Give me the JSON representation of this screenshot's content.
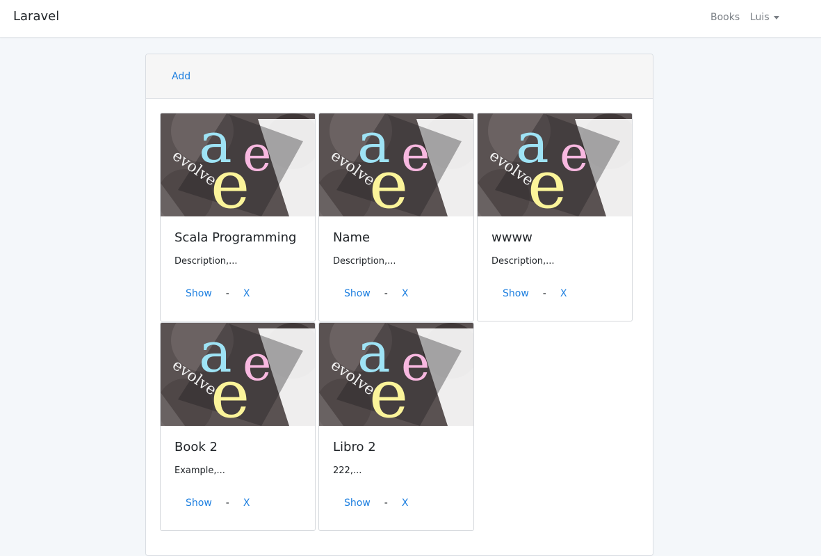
{
  "navbar": {
    "brand": "Laravel",
    "links": {
      "books": "Books",
      "user": "Luis"
    }
  },
  "panel": {
    "add_label": "Add"
  },
  "cover": {
    "word": "evolve",
    "letters": [
      "a",
      "e",
      "e"
    ]
  },
  "books": [
    {
      "title": "Scala Programming",
      "description": "Description,...",
      "show_label": "Show",
      "separator": "-",
      "delete_label": "X"
    },
    {
      "title": "Name",
      "description": "Description,...",
      "show_label": "Show",
      "separator": "-",
      "delete_label": "X"
    },
    {
      "title": "wwww",
      "description": "Description,...",
      "show_label": "Show",
      "separator": "-",
      "delete_label": "X"
    },
    {
      "title": "Book 2",
      "description": "Example,...",
      "show_label": "Show",
      "separator": "-",
      "delete_label": "X"
    },
    {
      "title": "Libro 2",
      "description": "222,...",
      "show_label": "Show",
      "separator": "-",
      "delete_label": "X"
    }
  ]
}
